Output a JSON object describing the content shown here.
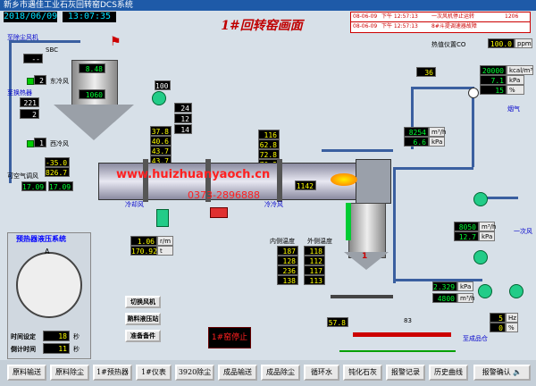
{
  "app_title": "新乡市遇佳工业石灰回转窑DCS系统",
  "date": "2018/06/09",
  "time": "13:07:35",
  "screen_title": "1#回转窑画面",
  "alarm_table": {
    "rows": [
      {
        "date": "08-06-09",
        "time": "下午 12:57:13",
        "text": "一次风机停止运转",
        "code": "1206"
      },
      {
        "date": "08-06-09",
        "time": "下午 12:57:13",
        "text": "8#斗提调速器故障",
        "code": ""
      }
    ]
  },
  "heat_label": "热值仪置CO",
  "heat_value": "100.0",
  "heat_unit": "ppm",
  "labels": {
    "top_wind": "至除尘风机",
    "sbc": "SBC",
    "east_fan": "东冷风",
    "west_fan": "西冷风",
    "preheat": "至换热器",
    "cold_wind": "冷却风",
    "kiln_head": "冷冷风",
    "smoke": "烟气",
    "primary_air": "一次风",
    "inner_temp": "内侧温度",
    "outer_temp": "外侧温度",
    "to_product": "至成品仓",
    "adjust": "可空气调风",
    "hydraulic_title": "预热器液压系统",
    "time_set": "时间设定",
    "time_count": "倒计时间",
    "sec": "秒",
    "center_A": "A",
    "watermark": "www.huizhuanyaoch.cn",
    "watermark2": "0373-2896888",
    "kiln_num": "1"
  },
  "values": {
    "top_small": "--",
    "tower_temp": "8.48",
    "tower_bottom": "1060",
    "east_val": "2",
    "west_val": "1",
    "preheat_v1": "221",
    "preheat_v2": "2",
    "fan100": "100",
    "mid1": "24",
    "mid2": "12",
    "mid3": "14",
    "left_a1": "-35.0",
    "left_a2": "826.7",
    "left_a3": "17.09",
    "left_a4": "17.09",
    "kiln_g1": "37.8",
    "kiln_g2": "40.6",
    "kiln_g3": "43.7",
    "kiln_g4": "43.7",
    "kiln_g5": "0.10",
    "kiln_r1": "116",
    "kiln_r2": "62.8",
    "kiln_r3": "72.8",
    "kiln_r4": "70.9",
    "kiln_r5": "79.7",
    "kiln_temp": "1142",
    "top_r1": "36",
    "flow1": "20000",
    "flow2": "7.1",
    "flow3": "15",
    "p1": "8254",
    "p2": "6.6",
    "v116": "116",
    "v115": "115",
    "v118": "118",
    "mid_fan": "1.06",
    "mid_fan2": "170.92",
    "v8050": "8050",
    "v127": "12.7",
    "v2329": "2.329",
    "v4800": "4800",
    "z5": "5",
    "z0": "0",
    "z57": "57.8",
    "z83": "83",
    "hyd_time_set": "18",
    "hyd_time_count": "11",
    "inner": [
      "187",
      "128",
      "236",
      "138"
    ],
    "outer": [
      "118",
      "112",
      "117",
      "113"
    ]
  },
  "units": {
    "kpa": "kPa",
    "m3h": "m³/h",
    "t": "t",
    "pct": "%",
    "degc": "℃",
    "hz": "Hz",
    "mm": "mm",
    "kcal": "kcal/m³",
    "rpm": "r/m"
  },
  "side_buttons": [
    "切换风机",
    "熟料液压站",
    "准备备件"
  ],
  "stop_button": "1#窑停止",
  "toolbar": [
    "原料输送",
    "原料除尘",
    "1#预热器",
    "1#仪表",
    "3920除尘",
    "成品输送",
    "成品除尘",
    "循环水",
    "钝化石灰",
    "报警记录",
    "历史曲线"
  ],
  "alarm_confirm": "报警确认",
  "colors": {
    "pipe": "#3a5fa0",
    "kiln": "#b8b8c8",
    "flame": "#ff6a00"
  }
}
